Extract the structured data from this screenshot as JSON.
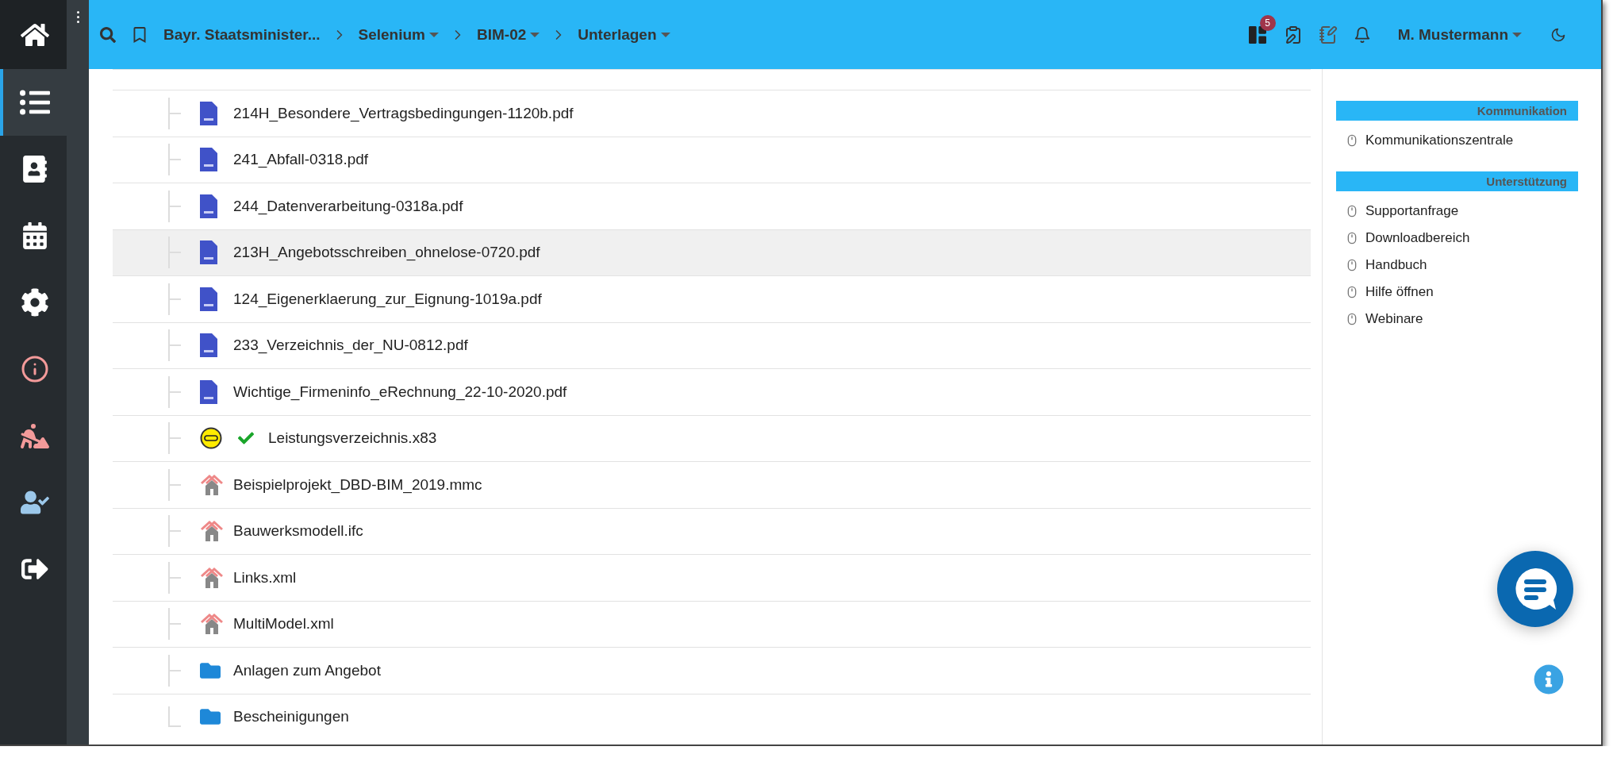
{
  "sidebar": {
    "items": [
      {
        "kind": "home",
        "selected": false
      },
      {
        "kind": "list",
        "selected": true
      },
      {
        "kind": "contacts",
        "selected": false
      },
      {
        "kind": "calendar",
        "selected": false
      },
      {
        "kind": "settings",
        "selected": false
      },
      {
        "kind": "info",
        "selected": false
      },
      {
        "kind": "worker",
        "selected": false
      },
      {
        "kind": "user-check",
        "selected": false
      },
      {
        "kind": "logout",
        "selected": false
      }
    ]
  },
  "breadcrumbs": [
    {
      "label": "Bayr. Staatsminister...",
      "dropdown": false
    },
    {
      "label": "Selenium",
      "dropdown": true
    },
    {
      "label": "BIM-02",
      "dropdown": true
    },
    {
      "label": "Unterlagen",
      "dropdown": true
    }
  ],
  "topbar": {
    "badge": "5",
    "user": "M. Mustermann"
  },
  "files": [
    {
      "kind": "pdf",
      "name": "214H_Besondere_Vertragsbedingungen-1120b.pdf",
      "selected": false,
      "verified": false
    },
    {
      "kind": "pdf",
      "name": "241_Abfall-0318.pdf",
      "selected": false,
      "verified": false
    },
    {
      "kind": "pdf",
      "name": "244_Datenverarbeitung-0318a.pdf",
      "selected": false,
      "verified": false
    },
    {
      "kind": "pdf",
      "name": "213H_Angebotsschreiben_ohnelose-0720.pdf",
      "selected": true,
      "verified": false
    },
    {
      "kind": "pdf",
      "name": "124_Eigenerklaerung_zur_Eignung-1019a.pdf",
      "selected": false,
      "verified": false
    },
    {
      "kind": "pdf",
      "name": "233_Verzeichnis_der_NU-0812.pdf",
      "selected": false,
      "verified": false
    },
    {
      "kind": "pdf",
      "name": "Wichtige_Firmeninfo_eRechnung_22-10-2020.pdf",
      "selected": false,
      "verified": false
    },
    {
      "kind": "gaeb",
      "name": "Leistungsverzeichnis.x83",
      "selected": false,
      "verified": true
    },
    {
      "kind": "model",
      "name": "Beispielprojekt_DBD-BIM_2019.mmc",
      "selected": false,
      "verified": false
    },
    {
      "kind": "model",
      "name": "Bauwerksmodell.ifc",
      "selected": false,
      "verified": false
    },
    {
      "kind": "model",
      "name": "Links.xml",
      "selected": false,
      "verified": false
    },
    {
      "kind": "model",
      "name": "MultiModel.xml",
      "selected": false,
      "verified": false
    },
    {
      "kind": "folder",
      "name": "Anlagen zum Angebot",
      "selected": false,
      "verified": false
    },
    {
      "kind": "folder",
      "name": "Bescheinigungen",
      "selected": false,
      "verified": false
    }
  ],
  "panel": {
    "sections": [
      {
        "title": "Kommunikation",
        "items": [
          "Kommunikationszentrale"
        ]
      },
      {
        "title": "Unterstützung",
        "items": [
          "Supportanfrage",
          "Downloadbereich",
          "Handbuch",
          "Hilfe öffnen",
          "Webinare"
        ]
      }
    ]
  }
}
